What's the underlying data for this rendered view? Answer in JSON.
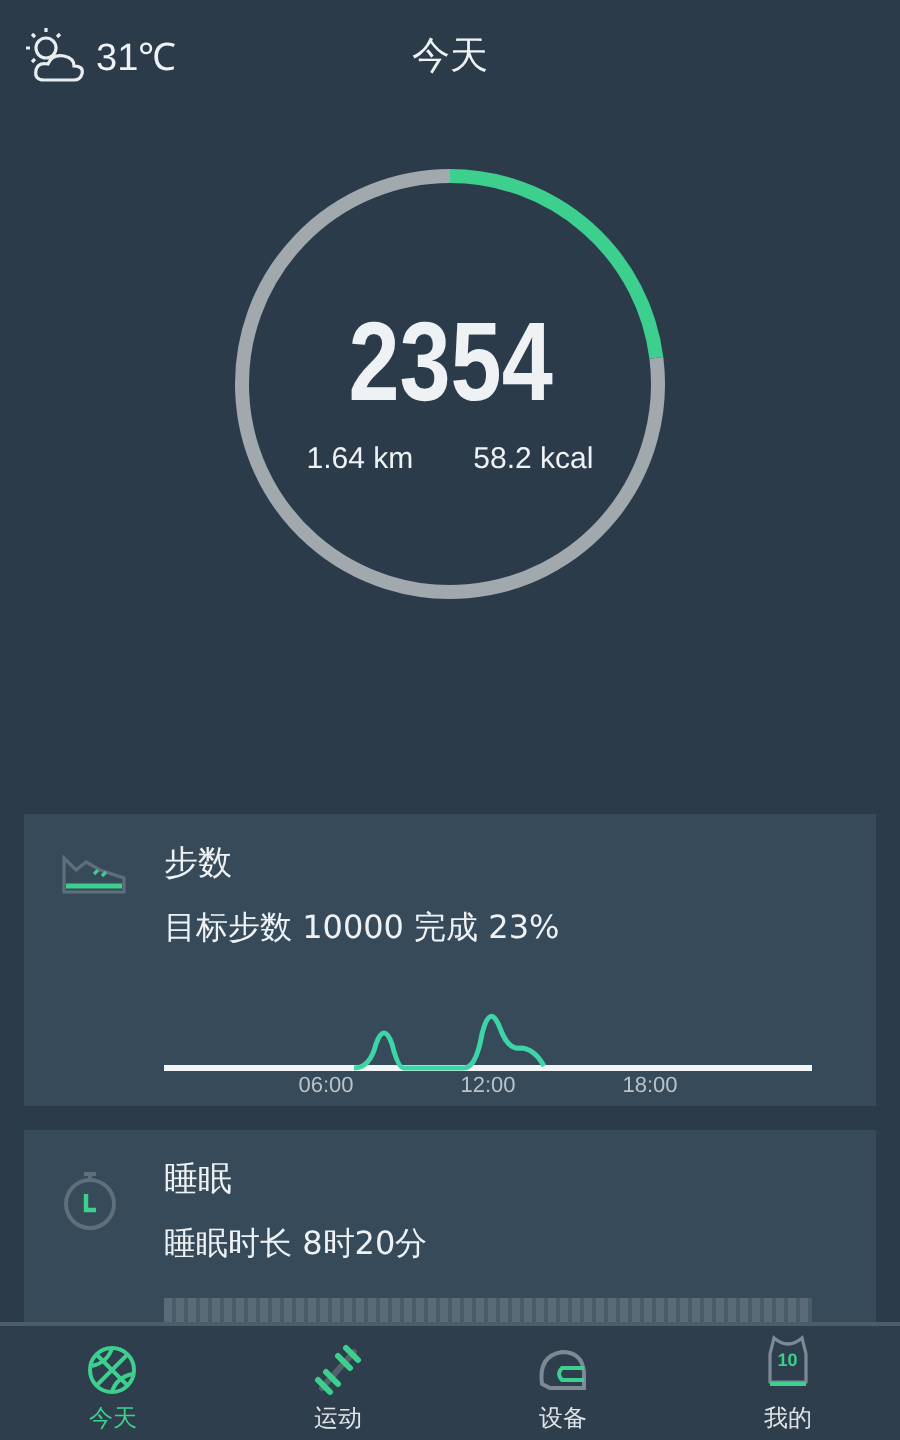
{
  "header": {
    "temperature": "31℃",
    "title": "今天"
  },
  "ring": {
    "steps": "2354",
    "distance": "1.64 km",
    "calories": "58.2 kcal"
  },
  "cards": [
    {
      "kind": "steps",
      "title": "步数",
      "detail": "目标步数 10000 完成 23%",
      "axis_labels": [
        "06:00",
        "12:00",
        "18:00"
      ]
    },
    {
      "kind": "sleep",
      "title": "睡眠",
      "detail": "睡眠时长 8时20分"
    }
  ],
  "nav": [
    {
      "kind": "ball",
      "label": "今天",
      "selected": true
    },
    {
      "kind": "dumbbell",
      "label": "运动",
      "selected": false
    },
    {
      "kind": "helmet",
      "label": "设备",
      "selected": false
    },
    {
      "kind": "jersey",
      "label": "我的",
      "selected": false,
      "badge": "10"
    }
  ]
}
